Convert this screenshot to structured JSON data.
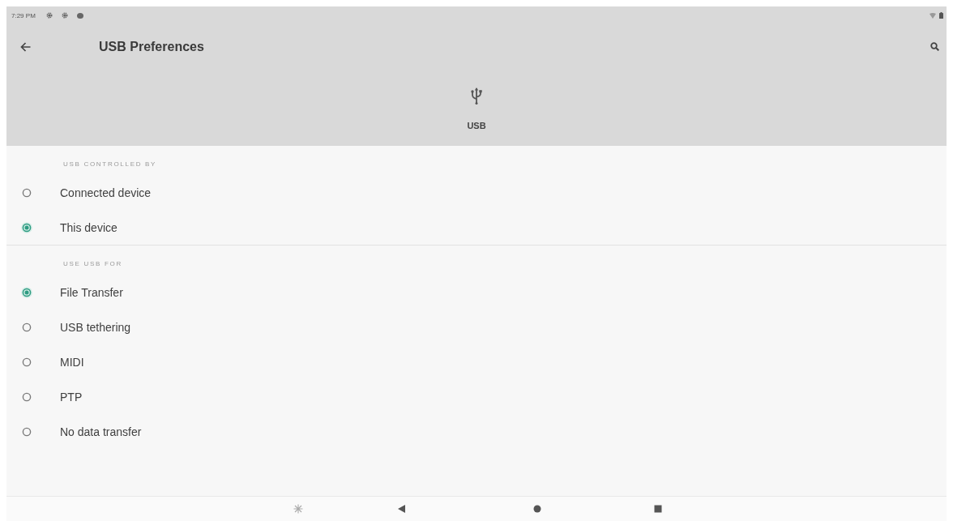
{
  "status_bar": {
    "time": "7:29 PM"
  },
  "toolbar": {
    "title": "USB Preferences"
  },
  "header": {
    "label": "USB"
  },
  "sections": [
    {
      "title": "USB CONTROLLED BY",
      "options": [
        {
          "label": "Connected device",
          "selected": false
        },
        {
          "label": "This device",
          "selected": true
        }
      ]
    },
    {
      "title": "USE USB FOR",
      "options": [
        {
          "label": "File Transfer",
          "selected": true
        },
        {
          "label": "USB tethering",
          "selected": false
        },
        {
          "label": "MIDI",
          "selected": false
        },
        {
          "label": "PTP",
          "selected": false
        },
        {
          "label": "No data transfer",
          "selected": false
        }
      ]
    }
  ]
}
